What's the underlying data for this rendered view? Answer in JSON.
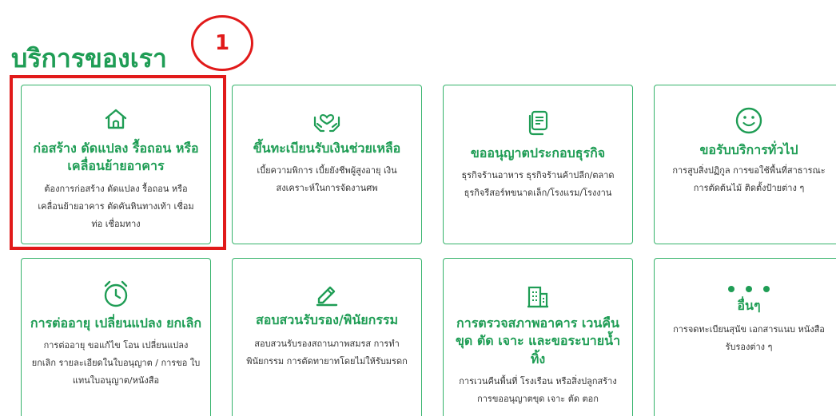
{
  "page": {
    "heading": "บริการของเรา",
    "callout_number": "1"
  },
  "colors": {
    "brand_green": "#1f9d55",
    "card_border": "#35b36b",
    "callout_red": "#e11a1a"
  },
  "services": [
    {
      "icon": "house-icon",
      "title": "ก่อสร้าง ดัดแปลง รื้อถอน หรือเคลื่อนย้ายอาคาร",
      "desc": "ต้องการก่อสร้าง ดัดแปลง รื้อถอน หรือ เคลื่อนย้ายอาคาร ตัดคันหินทางเท้า เชื่อม ท่อ เชื่อมทาง"
    },
    {
      "icon": "hands-heart-icon",
      "title": "ขึ้นทะเบียนรับเงินช่วยเหลือ",
      "desc": "เบี้ยความพิการ เบี้ยยังชีพผู้สูงอายุ เงิน สงเคราะห์ในการจัดงานศพ"
    },
    {
      "icon": "document-icon",
      "title": "ขออนุญาตประกอบธุรกิจ",
      "desc": "ธุรกิจร้านอาหาร ธุรกิจร้านค้าปลีก/ตลาด ธุรกิจรีสอร์ทขนาดเล็ก/โรงแรม/โรงงาน"
    },
    {
      "icon": "smile-icon",
      "title": "ขอรับบริการทั่วไป",
      "desc": "การสูบสิ่งปฏิกูล การขอใช้พื้นที่สาธารณะ การตัดต้นไม้ ติดตั้งป้ายต่าง ๆ"
    },
    {
      "icon": "alarm-clock-icon",
      "title": "การต่ออายุ เปลี่ยนแปลง ยกเลิก",
      "desc": "การต่ออายุ ขอแก้ไข โอน เปลี่ยนแปลง ยกเลิก รายละเอียดในใบอนุญาต / การขอ ใบแทนใบอนุญาต/หนังสือ"
    },
    {
      "icon": "pencil-icon",
      "title": "สอบสวนรับรอง/พินัยกรรม",
      "desc": "สอบสวนรับรองสถานภาพสมรส การทำ พินัยกรรม การตัดทายาทโดยไม่ให้รับมรดก"
    },
    {
      "icon": "building-icon",
      "title": "การตรวจสภาพอาคาร เวนคืน ขุด ตัด เจาะ และขอระบายน้ำทิ้ง",
      "desc": "การเวนคืนพื้นที่ โรงเรือน หรือสิ่งปลูกสร้าง การขออนุญาตขุด เจาะ ตัด ตอก"
    },
    {
      "icon": "more-dots-icon",
      "title": "อื่นๆ",
      "desc": "การจดทะเบียนสุนัข เอกสารแนบ หนังสือ รับรองต่าง ๆ"
    }
  ]
}
